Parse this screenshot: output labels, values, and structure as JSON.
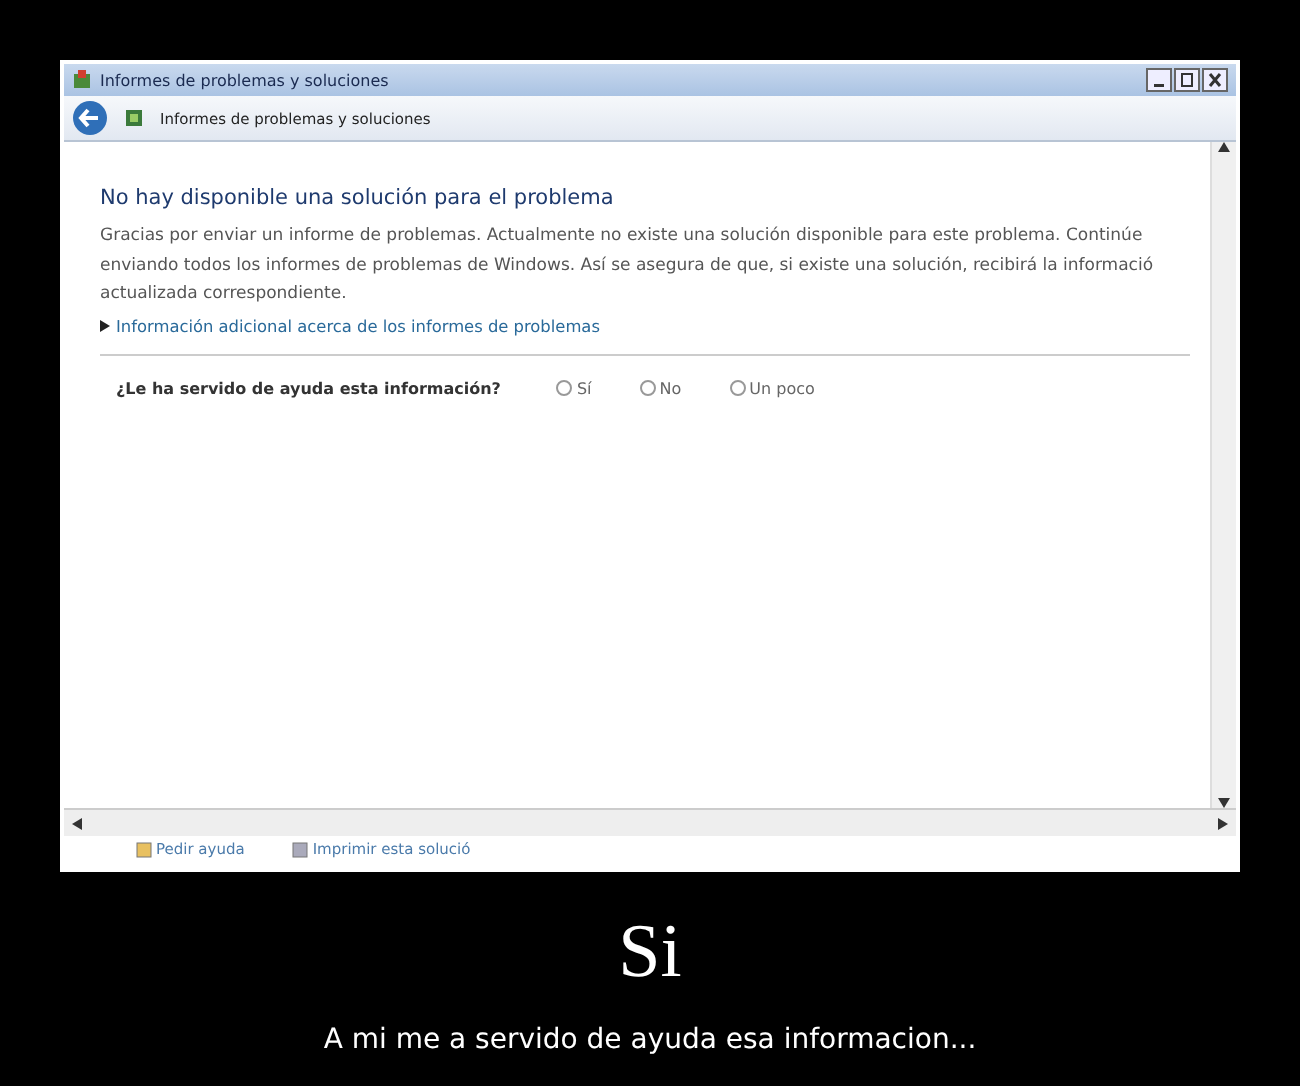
{
  "window": {
    "title": "Informes de problemas y soluciones"
  },
  "address_bar": {
    "location": "Informes de problemas y soluciones"
  },
  "content": {
    "heading": "No hay disponible una solución para el problema",
    "paragraph": "Gracias por enviar un informe de problemas. Actualmente no existe una solución disponible para este problema. Continúe enviando todos los informes de problemas de Windows. Así se asegura de que, si existe una solución, recibirá la informació actualizada correspondiente.",
    "more_info_link": "Información adicional acerca de los informes de problemas",
    "question": "¿Le ha servido de ayuda esta información?",
    "options": [
      {
        "label": "Sí",
        "selected": false
      },
      {
        "label": "No",
        "selected": false
      },
      {
        "label": "Un poco",
        "selected": false
      }
    ]
  },
  "footer_links": [
    "Pedir ayuda",
    "Imprimir esta solució"
  ],
  "poster": {
    "title": "Si",
    "caption": "A mi me a servido de ayuda esa informacion..."
  }
}
